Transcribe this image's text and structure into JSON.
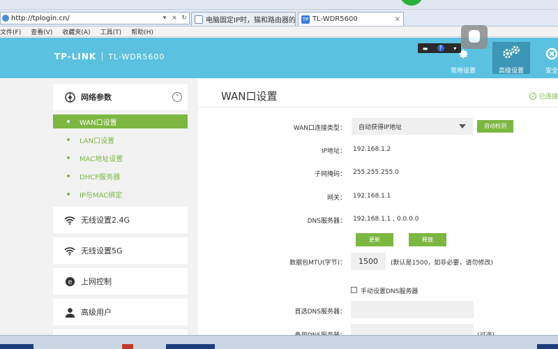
{
  "browser": {
    "url": "http://tplogin.cn/",
    "tabs": [
      {
        "label": "电脑固定IP时，猫和路由器的..."
      },
      {
        "label": "TL-WDR5600",
        "favicon": "TP"
      }
    ],
    "menu": [
      "文件(F)",
      "查看(V)",
      "收藏夹(A)",
      "工具(T)",
      "帮助(H)"
    ]
  },
  "header": {
    "brand": "TP-LINK",
    "model": "TL-WDR5600",
    "nav": [
      {
        "label": "常用设置",
        "icon": "gear-icon"
      },
      {
        "label": "高级设置",
        "icon": "gears-icon"
      },
      {
        "label": "安全",
        "icon": "shield-icon"
      }
    ]
  },
  "sidebar": {
    "section": "网络参数",
    "submenu": [
      "WAN口设置",
      "LAN口设置",
      "MAC地址设置",
      "DHCP服务器",
      "IP与MAC绑定"
    ],
    "items": [
      "无线设置2.4G",
      "无线设置5G",
      "上网控制",
      "高级用户"
    ]
  },
  "main": {
    "title": "WAN口设置",
    "status": "已连接",
    "wan_type_label": "WAN口连接类型：",
    "wan_type_value": "自动获得IP地址",
    "auto_detect": "自动检测",
    "ip_label": "IP地址：",
    "ip_value": "192.168.1.2",
    "mask_label": "子网掩码：",
    "mask_value": "255.255.255.0",
    "gateway_label": "网关：",
    "gateway_value": "192.168.1.1",
    "dns_label": "DNS服务器：",
    "dns_value": "192.168.1.1 , 0.0.0.0",
    "renew": "更新",
    "release": "释放",
    "mtu_label": "数据包MTU(字节)：",
    "mtu_value": "1500",
    "mtu_hint": "(默认是1500，如非必要，请勿修改)",
    "manual_dns": "手动设置DNS服务器",
    "primary_dns_label": "首选DNS服务器：",
    "secondary_dns_label": "备用DNS服务器：",
    "optional": "(可选)"
  },
  "colors": {
    "header": "#5bc1e0",
    "accent": "#7cb742",
    "nav_active": "#3b97b5"
  }
}
